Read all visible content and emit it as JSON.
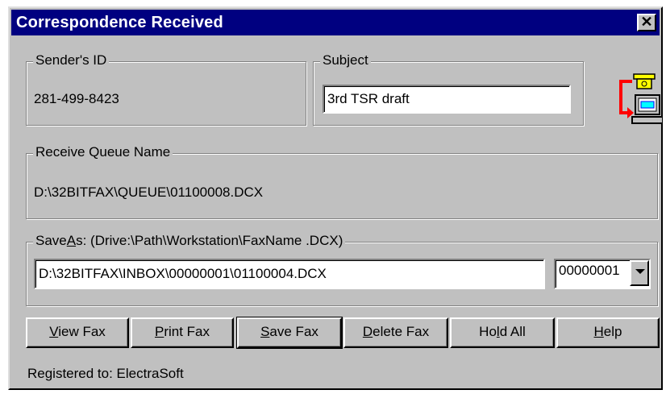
{
  "window": {
    "title": "Correspondence Received",
    "close_glyph": "✕"
  },
  "sender": {
    "legend": "Sender's ID",
    "value": "281-499-8423"
  },
  "subject": {
    "legend": "Subject",
    "value": "3rd TSR draft"
  },
  "queue": {
    "legend": "Receive Queue Name",
    "value": "D:\\32BITFAX\\QUEUE\\01100008.DCX"
  },
  "saveas": {
    "legend_pre": "Save",
    "legend_accel": "A",
    "legend_post": "s:  (Drive:\\Path\\Workstation\\FaxName .DCX)",
    "path_value": "D:\\32BITFAX\\INBOX\\00000001\\01100004.DCX",
    "workstation_selected": "00000001"
  },
  "buttons": {
    "view": {
      "accel": "V",
      "rest": "iew Fax"
    },
    "print": {
      "accel": "P",
      "rest": "rint Fax"
    },
    "save": {
      "accel": "S",
      "rest": "ave Fax"
    },
    "delete": {
      "accel": "D",
      "rest": "elete Fax"
    },
    "hold": {
      "pre": "Ho",
      "accel": "l",
      "rest": "d All"
    },
    "help": {
      "accel": "H",
      "rest": "elp"
    }
  },
  "status": {
    "registered": "Registered to: ElectraSoft"
  },
  "icons": {
    "fax_received": "fax-to-computer-icon",
    "close": "close-icon",
    "dropdown": "chevron-down-icon"
  },
  "colors": {
    "titlebar": "#000080",
    "face": "#c0c0c0",
    "arrow_red": "#ff0000"
  }
}
